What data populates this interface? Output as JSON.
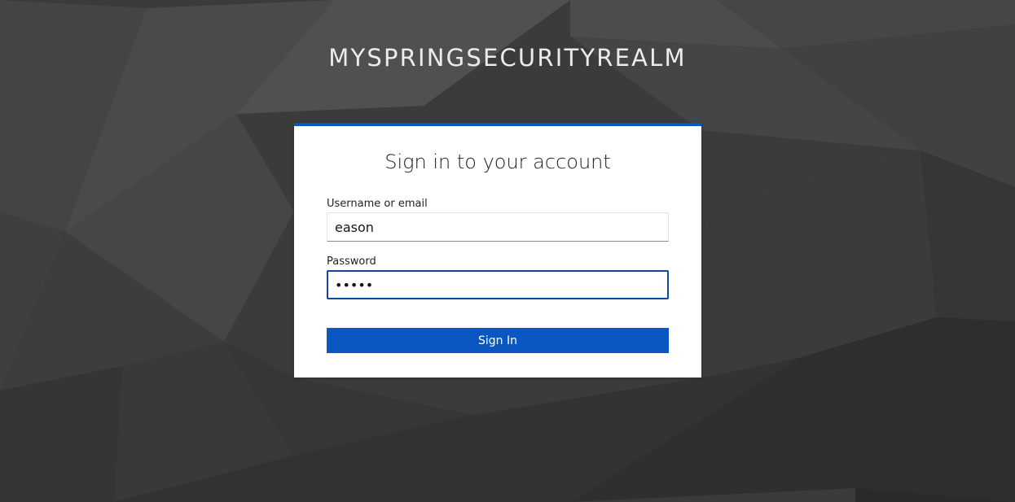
{
  "realm": {
    "title": "MYSPRINGSECURITYREALM"
  },
  "login": {
    "heading": "Sign in to your account",
    "username": {
      "label": "Username or email",
      "value": "eason"
    },
    "password": {
      "label": "Password",
      "value": "•••••"
    },
    "submit_label": "Sign In"
  },
  "colors": {
    "accent": "#0b57c2",
    "background": "#3a3a3a",
    "card": "#ffffff"
  }
}
